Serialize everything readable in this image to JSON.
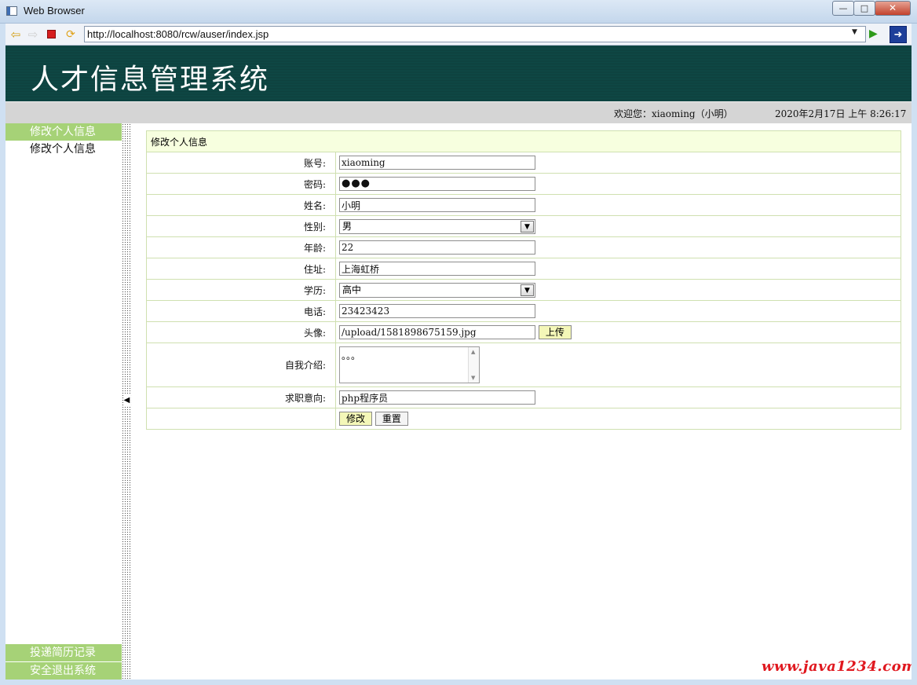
{
  "window": {
    "title": "Web Browser",
    "minimize": "—",
    "maximize": "□",
    "close": "✕"
  },
  "browser": {
    "url": "http://localhost:8080/rcw/auser/index.jsp"
  },
  "app": {
    "title": "人才信息管理系统",
    "welcome": "欢迎您：xiaoming（小明）",
    "datetime": "2020年2月17日 上午 8:26:17"
  },
  "sidebar": {
    "groups": [
      {
        "header": "修改个人信息",
        "items": [
          "修改个人信息"
        ]
      },
      {
        "header": "投递简历记录",
        "items": []
      },
      {
        "header": "安全退出系统",
        "items": []
      }
    ]
  },
  "form": {
    "title": "修改个人信息",
    "fields": {
      "account": {
        "label": "账号:",
        "value": "xiaoming"
      },
      "password": {
        "label": "密码:",
        "value": "●●●"
      },
      "name": {
        "label": "姓名:",
        "value": "小明"
      },
      "gender": {
        "label": "性别:",
        "value": "男"
      },
      "age": {
        "label": "年龄:",
        "value": "22"
      },
      "address": {
        "label": "住址:",
        "value": "上海虹桥"
      },
      "education": {
        "label": "学历:",
        "value": "高中"
      },
      "phone": {
        "label": "电话:",
        "value": "23423423"
      },
      "avatar": {
        "label": "头像:",
        "value": "/upload/1581898675159.jpg",
        "upload_label": "上传"
      },
      "intro": {
        "label": "自我介绍:",
        "value": "。。。"
      },
      "job_intention": {
        "label": "求职意向:",
        "value": "php程序员"
      }
    },
    "submit_label": "修改",
    "reset_label": "重置"
  },
  "watermark": "www.java1234.com",
  "colors": {
    "banner": "#0f4a47",
    "menu_header": "#a6d277",
    "form_header": "#f7ffdf",
    "watermark": "#e0181f"
  }
}
